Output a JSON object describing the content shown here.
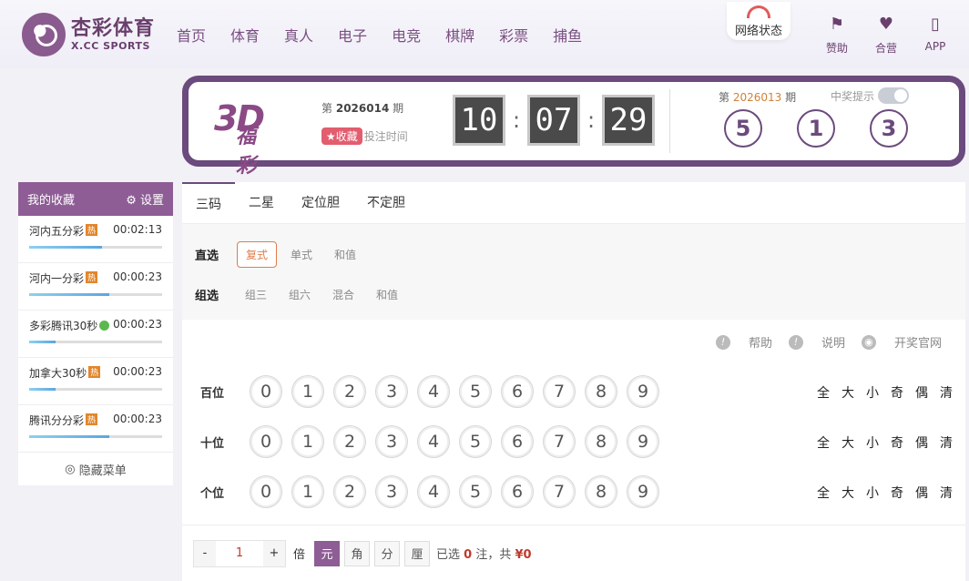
{
  "header": {
    "logo_cn": "杏彩体育",
    "logo_en": "X.CC SPORTS",
    "nav": [
      "首页",
      "体育",
      "真人",
      "电子",
      "电竞",
      "棋牌",
      "彩票",
      "捕鱼"
    ],
    "network_status": "网络状态",
    "icons": [
      {
        "label": "赞助",
        "icon": "star-badge-icon"
      },
      {
        "label": "合营",
        "icon": "handshake-icon"
      },
      {
        "label": "APP",
        "icon": "phone-icon"
      }
    ]
  },
  "banner": {
    "logo_big": "3D",
    "logo_small": "福彩",
    "issue_prefix": "第",
    "issue": "2026014",
    "issue_suffix": "期",
    "fav_label": "收藏",
    "bet_time_label": "投注时间",
    "countdown": {
      "h": "10",
      "m": "07",
      "s": "29"
    },
    "last_prefix": "第",
    "last_issue": "2026013",
    "last_suffix": "期",
    "win_alert": "中奖提示",
    "balls": [
      "5",
      "1",
      "3"
    ]
  },
  "sidebar": {
    "title": "我的收藏",
    "settings": "设置",
    "items": [
      {
        "name": "河内五分彩",
        "tag": "热",
        "time": "00:02:13",
        "progress": 55
      },
      {
        "name": "河内一分彩",
        "tag": "热",
        "time": "00:00:23",
        "progress": 60
      },
      {
        "name": "多彩腾讯30秒",
        "tag": "new",
        "time": "00:00:23",
        "progress": 20
      },
      {
        "name": "加拿大30秒",
        "tag": "热",
        "time": "00:00:23",
        "progress": 20
      },
      {
        "name": "腾讯分分彩",
        "tag": "热",
        "time": "00:00:23",
        "progress": 60
      }
    ],
    "hide_menu": "隐藏菜单"
  },
  "tabs": [
    "三码",
    "二星",
    "定位胆",
    "不定胆"
  ],
  "play": {
    "direct_label": "直选",
    "direct_options": [
      "复式",
      "单式",
      "和值"
    ],
    "group_label": "组选",
    "group_options": [
      "组三",
      "组六",
      "混合",
      "和值"
    ]
  },
  "help": [
    "帮助",
    "说明",
    "开奖官网"
  ],
  "positions": [
    {
      "label": "百位"
    },
    {
      "label": "十位"
    },
    {
      "label": "个位"
    }
  ],
  "digits": [
    "0",
    "1",
    "2",
    "3",
    "4",
    "5",
    "6",
    "7",
    "8",
    "9"
  ],
  "quick": [
    "全",
    "大",
    "小",
    "奇",
    "偶",
    "清"
  ],
  "bet": {
    "minus": "-",
    "multiplier": "1",
    "plus": "+",
    "bei": "倍",
    "units": [
      "元",
      "角",
      "分",
      "厘"
    ],
    "selected_prefix": "已选",
    "selected_count": "0",
    "selected_mid": "注，共",
    "amount": "¥0"
  }
}
